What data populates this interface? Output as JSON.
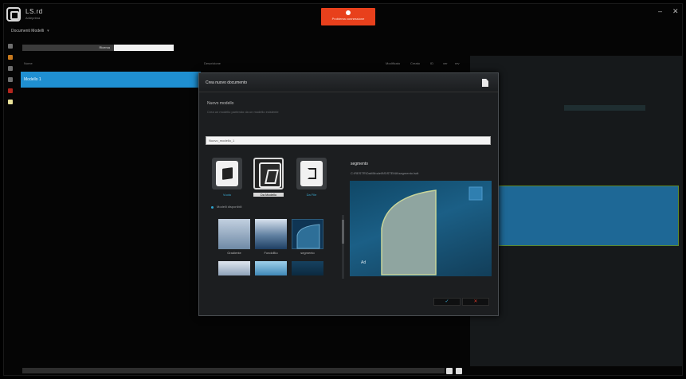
{
  "app": {
    "name": "LS.rd",
    "subtitle": "Anteprima",
    "workspace": "Documenti Modelli",
    "workspace_chevron": "▾",
    "window_controls": [
      "–",
      "✕"
    ]
  },
  "top_alert": {
    "text": "Problema connessione",
    "color": "#e8401c"
  },
  "path_bar": {
    "label": "Ricerca"
  },
  "list": {
    "headers": [
      "Nome",
      "Descrizione",
      "Modificato",
      "Creato",
      "ID",
      "ver",
      "rev"
    ],
    "selected_row": "Modello 1"
  },
  "rail_icons": [
    {
      "name": "documents-icon",
      "color": "#6f6f6f"
    },
    {
      "name": "folder-icon",
      "color": "#c87a1e"
    },
    {
      "name": "link-icon",
      "color": "#6f6f6f"
    },
    {
      "name": "settings-icon",
      "color": "#6f6f6f"
    },
    {
      "name": "alert-icon",
      "color": "#b3261e"
    },
    {
      "name": "note-icon",
      "color": "#e9e29a"
    }
  ],
  "dialog": {
    "title": "Crea nuovo documento",
    "section_title": "Nuovo modello",
    "section_desc": "Crea un modello partendo da un modello esistente",
    "name_input_value": "Nuovo_modello_1",
    "sources": [
      {
        "label": "Vuoto",
        "icon": "cube-icon"
      },
      {
        "label": "Da Modello",
        "icon": "template-icon",
        "selected": true
      },
      {
        "label": "Da File",
        "icon": "import-icon"
      }
    ],
    "tree_label": "Modelli disponibili",
    "templates": [
      {
        "label": "Gradiente"
      },
      {
        "label": "FondoBlu"
      },
      {
        "label": "segmento"
      }
    ],
    "preview": {
      "title": "segmento",
      "path": "C:\\RESTR\\Dati\\Modelli\\SISTEMA\\segmento.lsdt",
      "corner_text": "Ad"
    },
    "ok_icon": "✓",
    "cancel_icon": "✕",
    "accent": "#39a8cf",
    "cancel_color": "#d4372a"
  }
}
